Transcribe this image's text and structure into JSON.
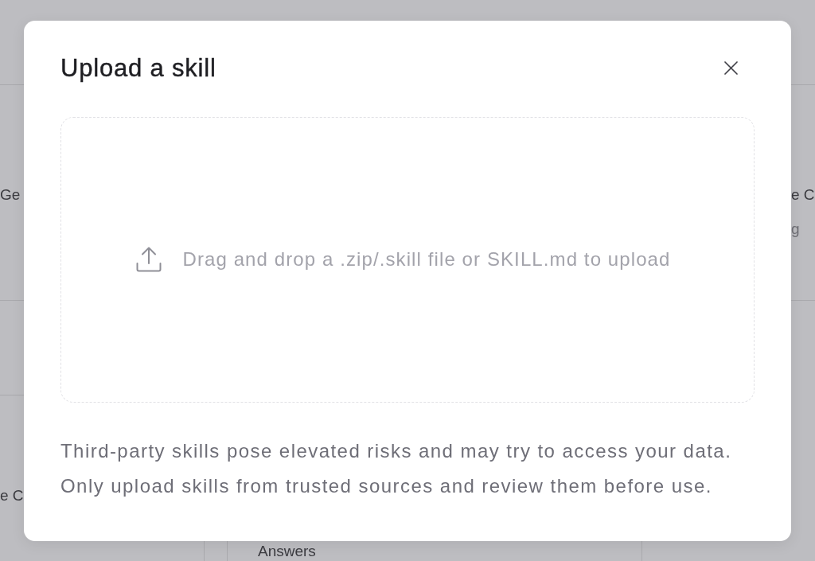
{
  "background_cards": [
    {
      "title": "Ge"
    },
    {
      "title": "e C",
      "subtitle": "g"
    },
    {
      "title": "e C"
    },
    {
      "title": "Answers"
    }
  ],
  "dialog": {
    "title": "Upload a skill",
    "dropzone": {
      "prompt": "Drag and drop a .zip/.skill file or SKILL.md to upload"
    },
    "notice": [
      "Third-party skills pose elevated risks and may try to access your data.",
      "Only upload skills from trusted sources and review them before use."
    ]
  }
}
